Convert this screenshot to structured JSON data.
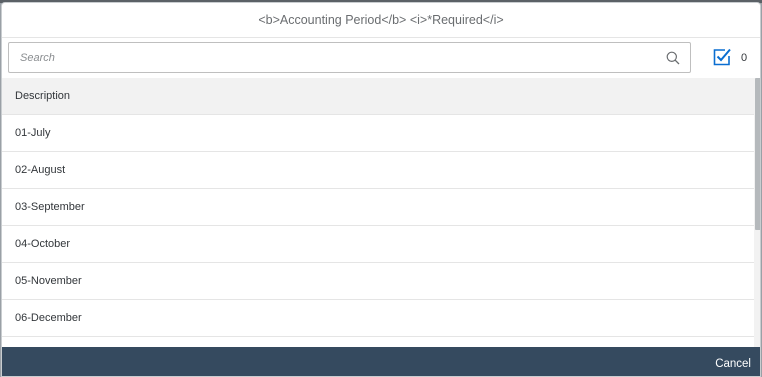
{
  "dialog": {
    "title": "<b>Accounting Period</b> <i>*Required</i>"
  },
  "search": {
    "placeholder": "Search",
    "value": "",
    "icon": "search-icon"
  },
  "selected": {
    "icon": "checkbox-checked-icon",
    "count": "0"
  },
  "table": {
    "column_header": "Description",
    "rows": [
      {
        "label": "01-July"
      },
      {
        "label": "02-August"
      },
      {
        "label": "03-September"
      },
      {
        "label": "04-October"
      },
      {
        "label": "05-November"
      },
      {
        "label": "06-December"
      }
    ]
  },
  "footer": {
    "cancel_label": "Cancel"
  },
  "colors": {
    "footer_bg": "#354a5f",
    "header_row_bg": "#f2f2f2",
    "text": "#32363a"
  }
}
